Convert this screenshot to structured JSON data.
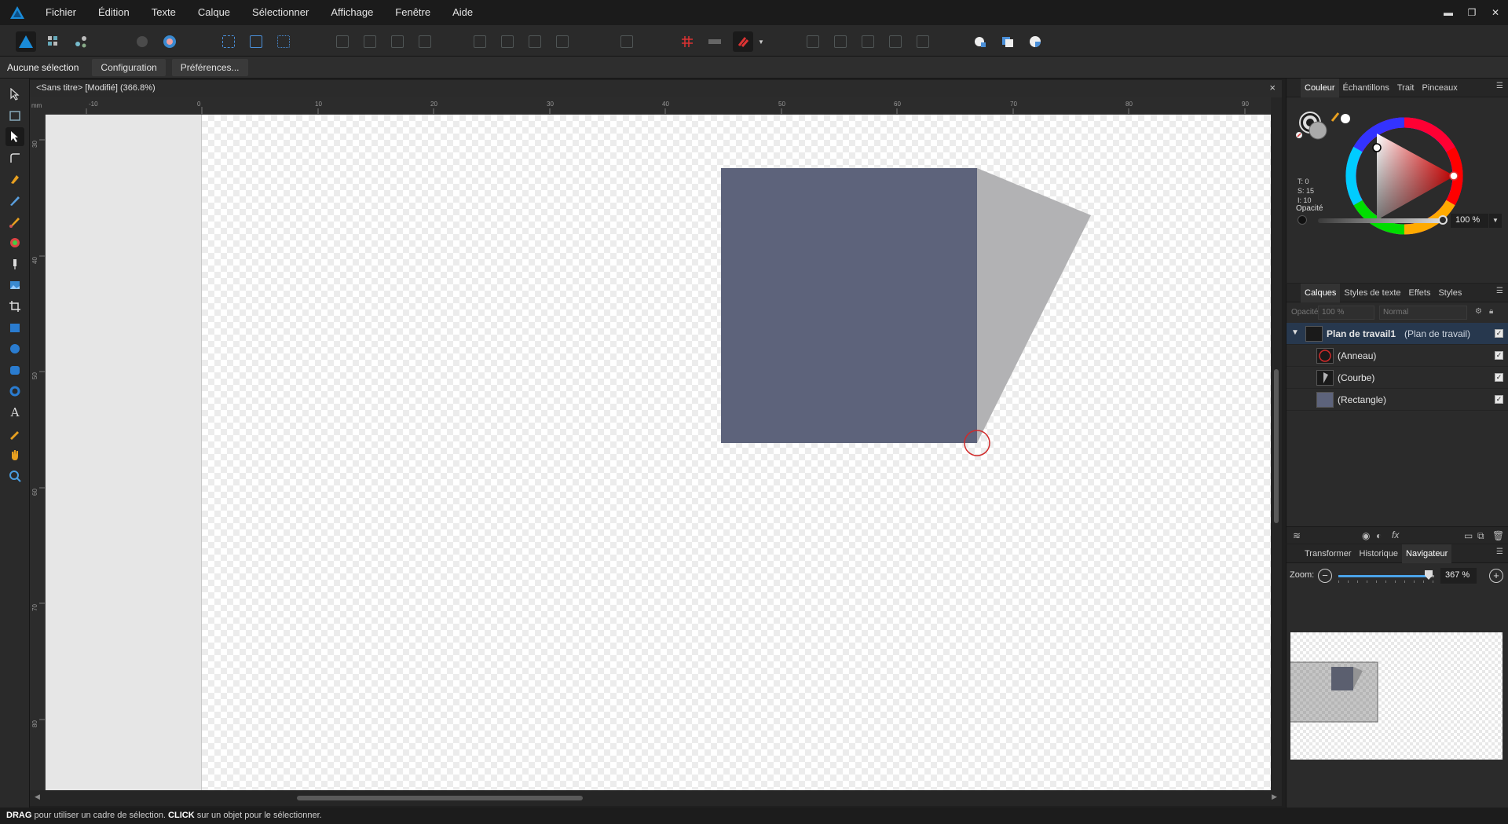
{
  "app": {
    "menu": [
      "Fichier",
      "Édition",
      "Texte",
      "Calque",
      "Sélectionner",
      "Affichage",
      "Fenêtre",
      "Aide"
    ],
    "window_controls": [
      "minimize-icon",
      "restore-icon",
      "close-icon"
    ]
  },
  "context_bar": {
    "selection_label": "Aucune sélection",
    "configuration_label": "Configuration",
    "preferences_label": "Préférences..."
  },
  "document": {
    "title": "<Sans titre> [Modifié] (366.8%)",
    "close_glyph": "×",
    "ruler_unit": "mm",
    "ruler_h_ticks": [
      "-10",
      "0",
      "10",
      "20",
      "30",
      "40",
      "50",
      "60",
      "70",
      "80",
      "90"
    ],
    "ruler_v_ticks": [
      "30",
      "40",
      "50",
      "60",
      "70",
      "80"
    ]
  },
  "canvas_shapes": {
    "rectangle_color": "#5d637b",
    "curve_color": "#b2b2b4",
    "ring_color": "#d12a2a"
  },
  "color_panel": {
    "tabs": [
      "Couleur",
      "Échantillons",
      "Trait",
      "Pinceaux"
    ],
    "readout_t": "T: 0",
    "readout_s": "S: 15",
    "readout_l": "I: 10",
    "opacity_label": "Opacité",
    "opacity_value": "100 %",
    "opacity_percent": 100
  },
  "layers_panel": {
    "tabs": [
      "Calques",
      "Styles de texte",
      "Effets",
      "Styles"
    ],
    "opacity_label": "Opacité:",
    "opacity_value": "100 %",
    "blend_mode": "Normal",
    "artboard_name": "Plan de travail1",
    "artboard_type": "(Plan de travail)",
    "layers": [
      "(Anneau)",
      "(Courbe)",
      "(Rectangle)"
    ]
  },
  "navigator_panel": {
    "tabs": [
      "Transformer",
      "Historique",
      "Navigateur"
    ],
    "zoom_label": "Zoom:",
    "zoom_value": "367 %",
    "minus_glyph": "−",
    "plus_glyph": "+"
  },
  "status_bar": {
    "drag_key": "DRAG",
    "drag_text": " pour utiliser un cadre de sélection. ",
    "click_key": "CLICK",
    "click_text": " sur un objet pour le sélectionner."
  }
}
